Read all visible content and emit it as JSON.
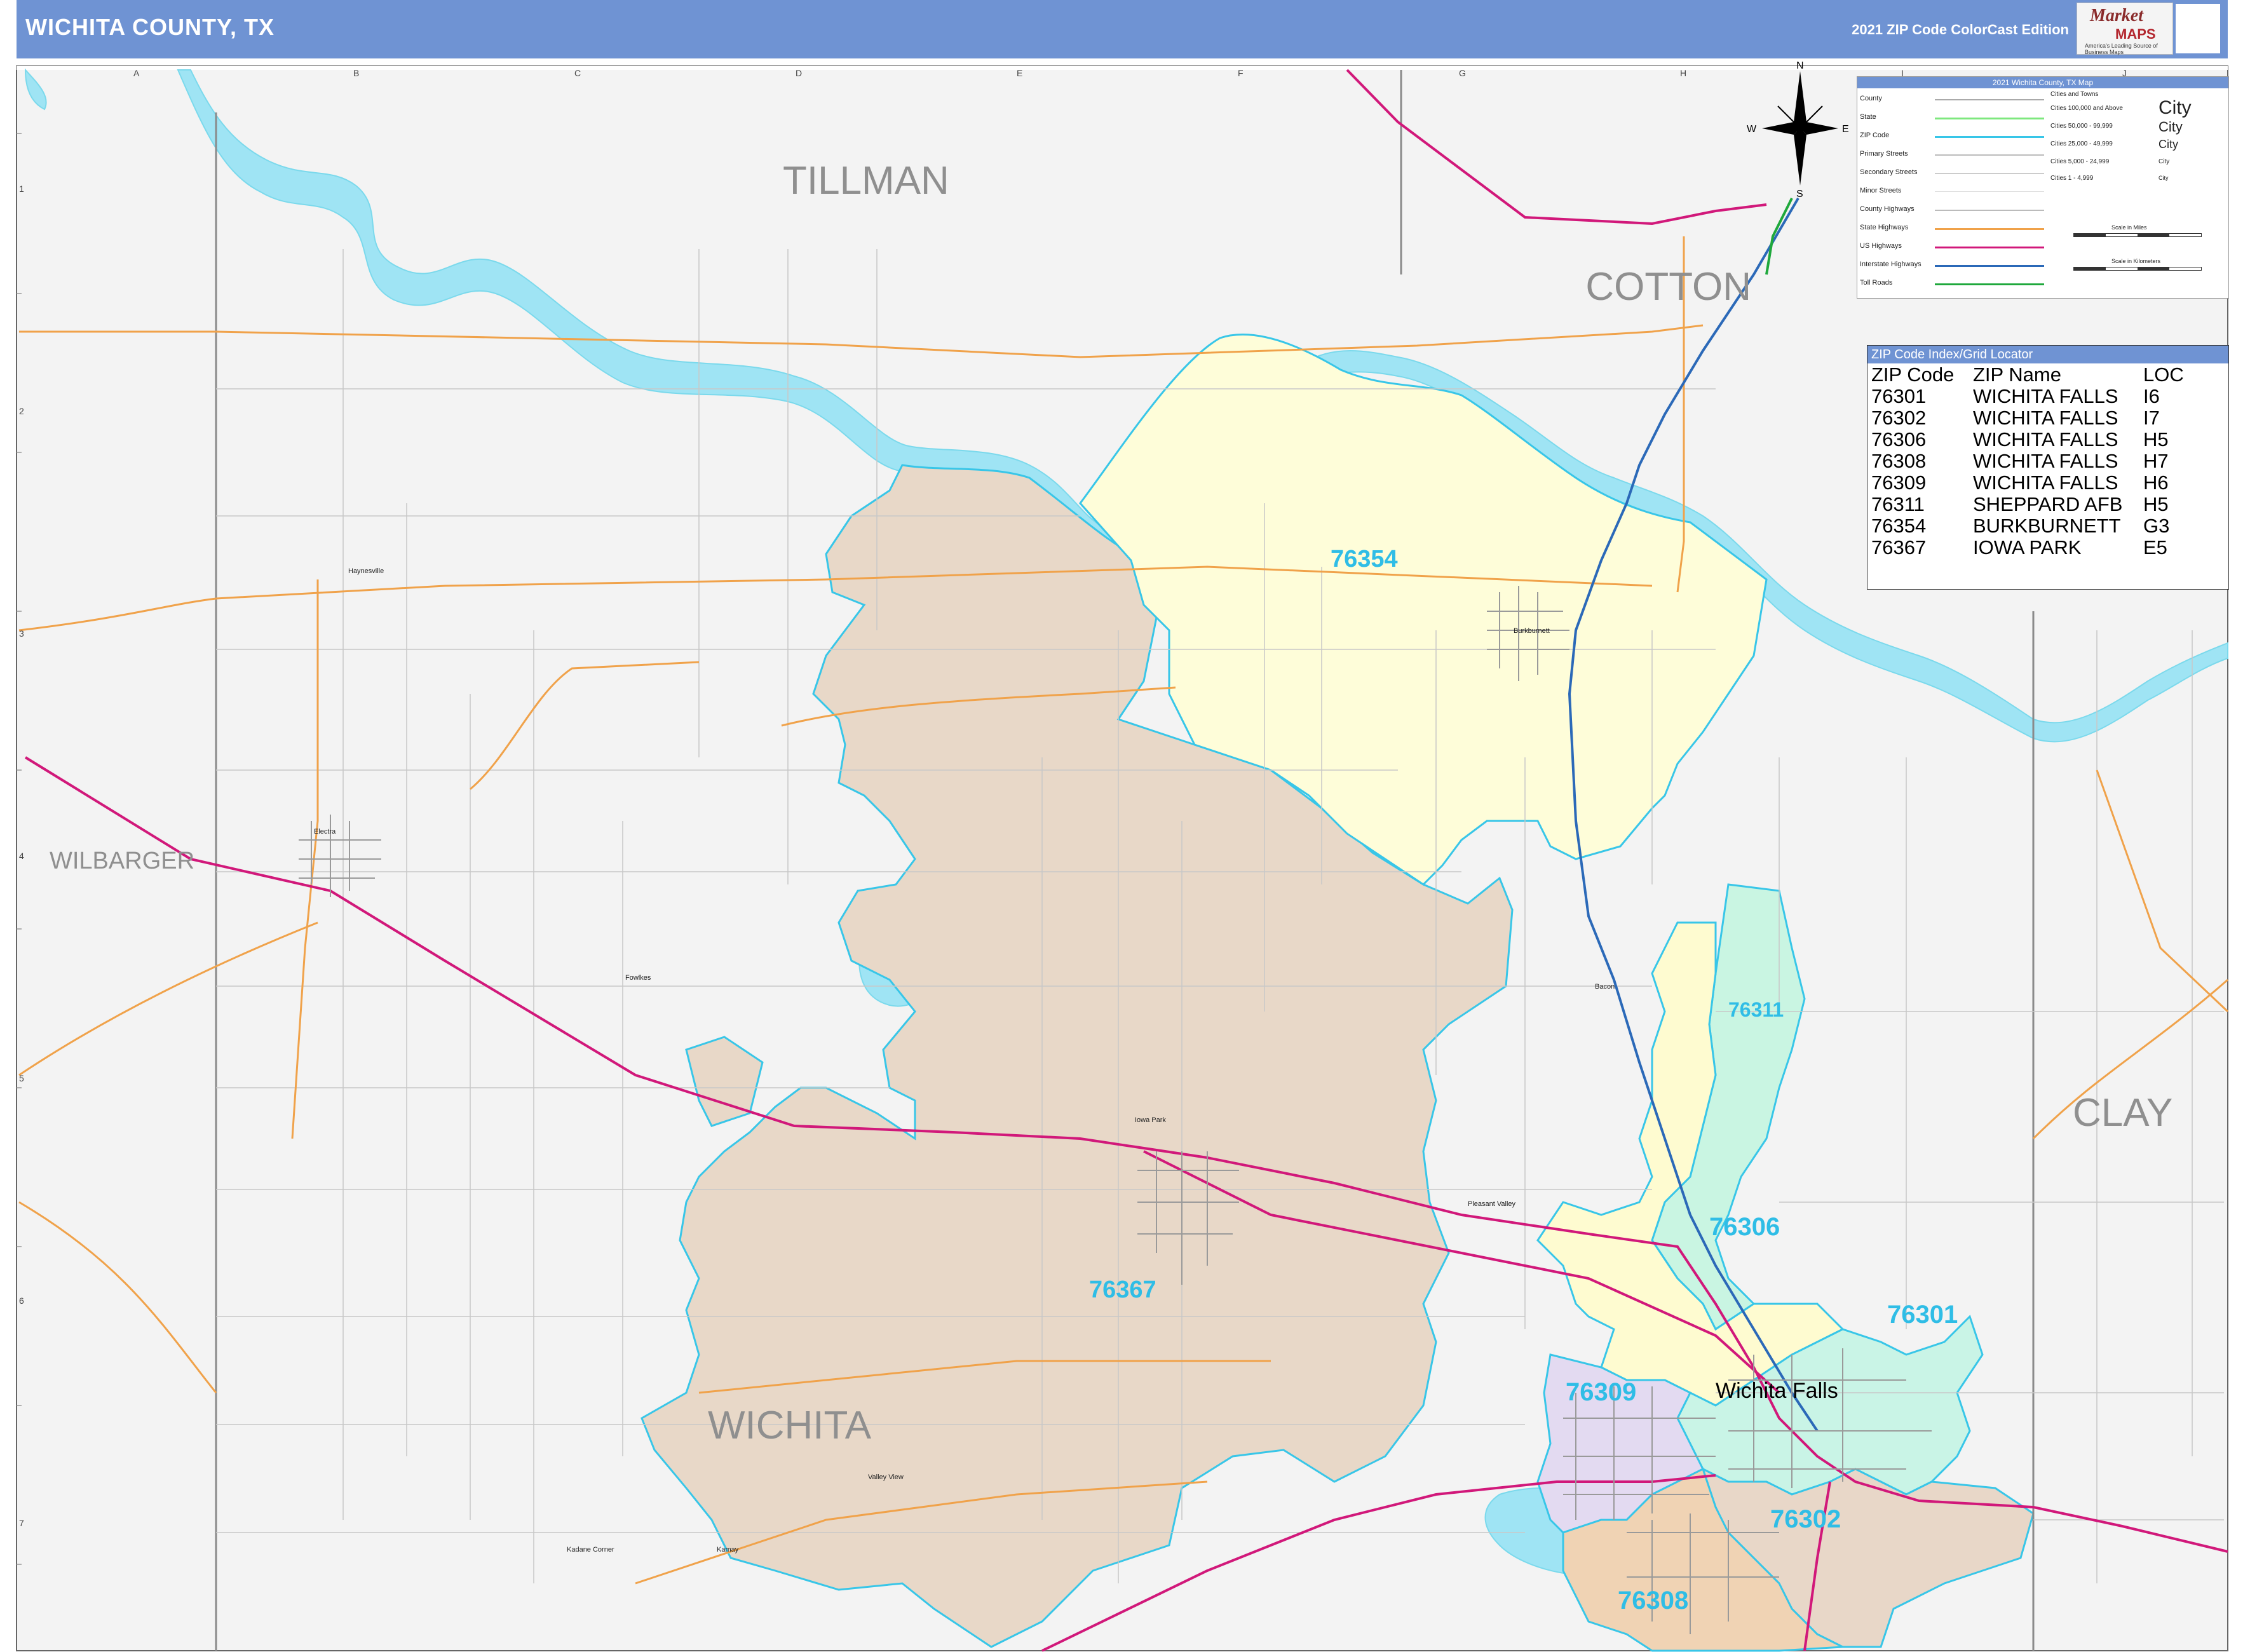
{
  "header": {
    "title": "WICHITA COUNTY, TX",
    "edition": "2021 ZIP Code ColorCast Edition",
    "logo_line1": "Market",
    "logo_line2": "MAPS",
    "logo_tagline": "America's Leading Source of Business Maps"
  },
  "map": {
    "county_labels": {
      "tillman": "TILLMAN",
      "cotton": "COTTON",
      "wilbarger": "WILBARGER",
      "clay": "CLAY",
      "wichita": "WICHITA"
    },
    "zip_labels": {
      "z76354": "76354",
      "z76311": "76311",
      "z76367": "76367",
      "z76306": "76306",
      "z76301": "76301",
      "z76309": "76309",
      "z76302": "76302",
      "z76308": "76308"
    },
    "city_label": "Wichita Falls",
    "small_places": {
      "burkburnett": "Burkburnett",
      "iowa_park": "Iowa Park",
      "electra": "Electra",
      "haynesville": "Haynesville",
      "fowlkes": "Fowlkes",
      "bacon": "Bacon",
      "pleasant_valley": "Pleasant Valley",
      "valley_view": "Valley View",
      "kadane_corner": "Kadane Corner",
      "kemp": "Kamay"
    },
    "grid_columns": [
      "A",
      "B",
      "C",
      "D",
      "E",
      "F",
      "G",
      "H",
      "I",
      "J"
    ],
    "grid_rows": [
      "1",
      "2",
      "3",
      "4",
      "5",
      "6",
      "7"
    ],
    "compass": {
      "n": "N",
      "s": "S",
      "e": "E",
      "w": "W"
    },
    "colors": {
      "z76354": "#fefdd9",
      "z76367": "#e8d8c8",
      "z76311": "#c9f5e2",
      "z76306": "#fefbd0",
      "z76301": "#c9f4e6",
      "z76309": "#e3daf1",
      "z76302": "#e8d7c8",
      "z76308": "#f0d3b4",
      "water": "#9fe4f4",
      "zip_border": "#38c6e8",
      "us_highway": "#d1187a",
      "interstate": "#2b69b8",
      "state_highway": "#f0a24a"
    }
  },
  "legend": {
    "title": "2021 Wichita County, TX Map",
    "rows": [
      "County",
      "State",
      "ZIP Code",
      "Primary Streets",
      "Secondary Streets",
      "Minor Streets",
      "County Highways",
      "State Highways",
      "US Highways",
      "Interstate Highways",
      "Toll Roads"
    ],
    "cities_title": "Cities and Towns",
    "city_sizes": [
      {
        "range": "Cities 100,000 and Above",
        "sample": "City"
      },
      {
        "range": "Cities 50,000 - 99,999",
        "sample": "City"
      },
      {
        "range": "Cities 25,000 - 49,999",
        "sample": "City"
      },
      {
        "range": "Cities 5,000 - 24,999",
        "sample": "City"
      },
      {
        "range": "Cities 1 - 4,999",
        "sample": "City"
      }
    ],
    "scale_miles": "Scale in Miles",
    "scale_km": "Scale in Kilometers"
  },
  "zip_index": {
    "title": "ZIP Code Index/Grid Locator",
    "columns": [
      "ZIP Code",
      "ZIP Name",
      "LOC"
    ],
    "rows": [
      {
        "zip": "76301",
        "name": "WICHITA FALLS",
        "loc": "I6"
      },
      {
        "zip": "76302",
        "name": "WICHITA FALLS",
        "loc": "I7"
      },
      {
        "zip": "76306",
        "name": "WICHITA FALLS",
        "loc": "H5"
      },
      {
        "zip": "76308",
        "name": "WICHITA FALLS",
        "loc": "H7"
      },
      {
        "zip": "76309",
        "name": "WICHITA FALLS",
        "loc": "H6"
      },
      {
        "zip": "76311",
        "name": "SHEPPARD AFB",
        "loc": "H5"
      },
      {
        "zip": "76354",
        "name": "BURKBURNETT",
        "loc": "G3"
      },
      {
        "zip": "76367",
        "name": "IOWA PARK",
        "loc": "E5"
      }
    ]
  }
}
